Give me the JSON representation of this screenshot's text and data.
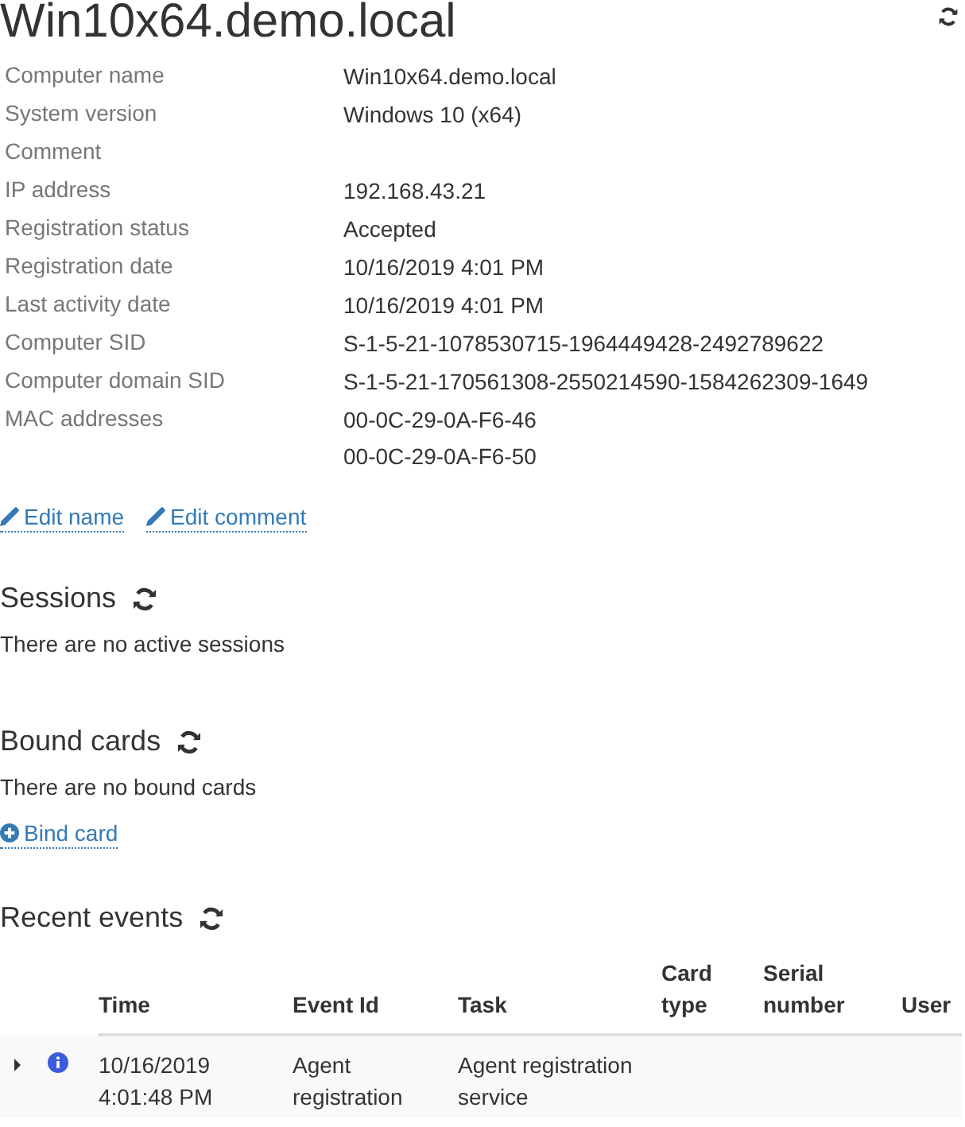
{
  "title": "Win10x64.demo.local",
  "properties": [
    {
      "label": "Computer name",
      "values": [
        "Win10x64.demo.local"
      ]
    },
    {
      "label": "System version",
      "values": [
        "Windows 10 (x64)"
      ]
    },
    {
      "label": "Comment"
    },
    {
      "label": "IP address",
      "values": [
        "192.168.43.21"
      ]
    },
    {
      "label": "Registration status",
      "values": [
        "Accepted"
      ]
    },
    {
      "label": "Registration date",
      "values": [
        "10/16/2019 4:01 PM"
      ]
    },
    {
      "label": "Last activity date",
      "values": [
        "10/16/2019 4:01 PM"
      ]
    },
    {
      "label": "Computer SID",
      "values": [
        "S-1-5-21-1078530715-1964449428-2492789622"
      ]
    },
    {
      "label": "Computer domain SID",
      "values": [
        "S-1-5-21-170561308-2550214590-1584262309-1649"
      ]
    },
    {
      "label": "MAC addresses",
      "values": [
        "00-0C-29-0A-F6-46",
        "00-0C-29-0A-F6-50"
      ]
    }
  ],
  "actions": [
    {
      "label": "Edit name",
      "kind": "edit"
    },
    {
      "label": "Edit comment",
      "kind": "edit"
    }
  ],
  "sessions": {
    "heading": "Sessions",
    "empty_text": "There are no active sessions"
  },
  "bound_cards": {
    "heading": "Bound cards",
    "empty_text": "There are no bound cards",
    "action": {
      "label": "Bind card",
      "kind": "add"
    }
  },
  "recent_events": {
    "heading": "Recent events",
    "columns": [
      "Time",
      "Event Id",
      "Task",
      "Card type",
      "Serial number",
      "User"
    ],
    "rows": [
      {
        "expanded": false,
        "kind": "info",
        "cells": [
          "10/16/2019 4:01:48 PM",
          "Agent registration",
          "Agent registration service"
        ]
      }
    ]
  }
}
